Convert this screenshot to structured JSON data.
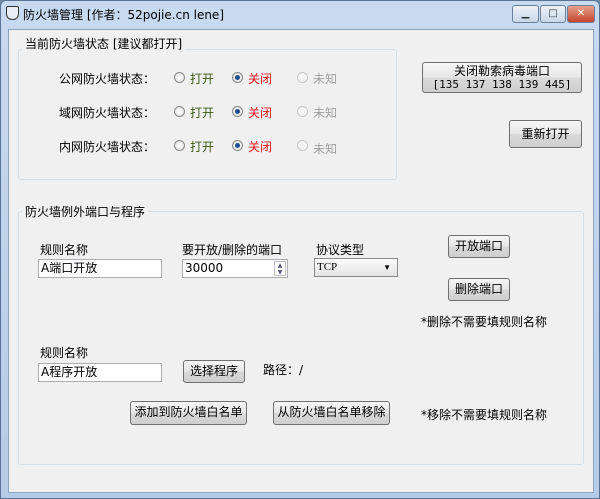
{
  "window": {
    "title": "防火墙管理 [作者：52pojie.cn lene]"
  },
  "status_group": {
    "title": "当前防火墙状态 [建议都打开]",
    "rows": [
      {
        "label": "公网防火墙状态：",
        "open": "打开",
        "closed": "关闭",
        "unknown": "未知",
        "selected": "closed"
      },
      {
        "label": "域网防火墙状态：",
        "open": "打开",
        "closed": "关闭",
        "unknown": "未知",
        "selected": "closed"
      },
      {
        "label": "内网防火墙状态：",
        "open": "打开",
        "closed": "关闭",
        "unknown": "未知",
        "selected": "closed"
      }
    ]
  },
  "buttons": {
    "close_ransom_line1": "关闭勒索病毒端口",
    "close_ransom_line2": "[135 137 138 139 445]",
    "reopen": "重新打开"
  },
  "exception_group": {
    "title": "防火墙例外端口与程序",
    "rule_name_label": "规则名称",
    "rule_name_value": "A端口开放",
    "port_label": "要开放/删除的端口",
    "port_value": "30000",
    "protocol_label": "协议类型",
    "protocol_value": "TCP",
    "open_port": "开放端口",
    "delete_port": "删除端口",
    "delete_note": "*删除不需要填规则名称",
    "prog_rule_label": "规则名称",
    "prog_rule_value": "A程序开放",
    "select_program": "选择程序",
    "path_label": "路径：/",
    "add_whitelist": "添加到防火墙白名单",
    "remove_whitelist": "从防火墙白名单移除",
    "remove_note": "*移除不需要填规则名称"
  }
}
